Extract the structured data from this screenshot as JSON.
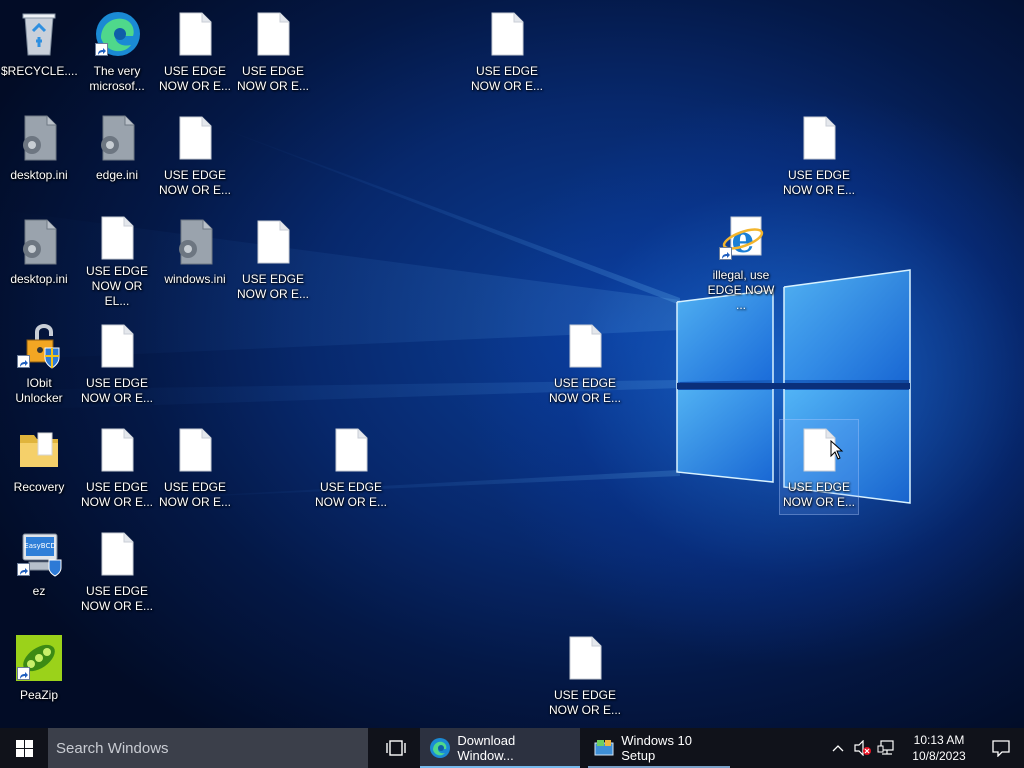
{
  "desktop": {
    "icons": [
      {
        "label": "$RECYCLE....",
        "kind": "recycle"
      },
      {
        "label": "The very\nmicrosof...",
        "kind": "edge"
      },
      {
        "label": "USE EDGE\nNOW OR E...",
        "kind": "file"
      },
      {
        "label": "USE EDGE\nNOW OR E...",
        "kind": "file"
      },
      {
        "label": "USE EDGE\nNOW OR E...",
        "kind": "file"
      },
      {
        "label": "desktop.ini",
        "kind": "gearfile"
      },
      {
        "label": "edge.ini",
        "kind": "gearfile"
      },
      {
        "label": "USE EDGE\nNOW OR E...",
        "kind": "file"
      },
      {
        "label": "USE EDGE\nNOW OR E...",
        "kind": "file"
      },
      {
        "label": "desktop.ini",
        "kind": "gearfile"
      },
      {
        "label": "USE EDGE\nNOW OR EL...",
        "kind": "file"
      },
      {
        "label": "windows.ini",
        "kind": "gearfile"
      },
      {
        "label": "USE EDGE\nNOW OR E...",
        "kind": "file"
      },
      {
        "label": "illegal, use\nEDGE NOW ...",
        "kind": "ie"
      },
      {
        "label": "IObit\nUnlocker",
        "kind": "iobit"
      },
      {
        "label": "USE EDGE\nNOW OR E...",
        "kind": "file"
      },
      {
        "label": "USE EDGE\nNOW OR E...",
        "kind": "file"
      },
      {
        "label": "Recovery",
        "kind": "folder"
      },
      {
        "label": "USE EDGE\nNOW OR E...",
        "kind": "file"
      },
      {
        "label": "USE EDGE\nNOW OR E...",
        "kind": "file"
      },
      {
        "label": "USE EDGE\nNOW OR E...",
        "kind": "file"
      },
      {
        "label": "USE EDGE\nNOW OR E...",
        "kind": "file"
      },
      {
        "label": "ez",
        "kind": "ez"
      },
      {
        "label": "USE EDGE\nNOW OR E...",
        "kind": "file"
      },
      {
        "label": "PeaZip",
        "kind": "peazip"
      },
      {
        "label": "USE EDGE\nNOW OR E...",
        "kind": "file"
      }
    ]
  },
  "taskbar": {
    "search_placeholder": "Search Windows",
    "tasks": [
      {
        "label": "Download Window..."
      },
      {
        "label": "Windows 10 Setup"
      }
    ],
    "clock": {
      "time": "10:13 AM",
      "date": "10/8/2023"
    }
  },
  "colors": {
    "taskbar_bg": "#10121a",
    "search_bg": "#3b3f4a",
    "active_task_bg": "#2c3140",
    "accent": "#76b9ed"
  }
}
